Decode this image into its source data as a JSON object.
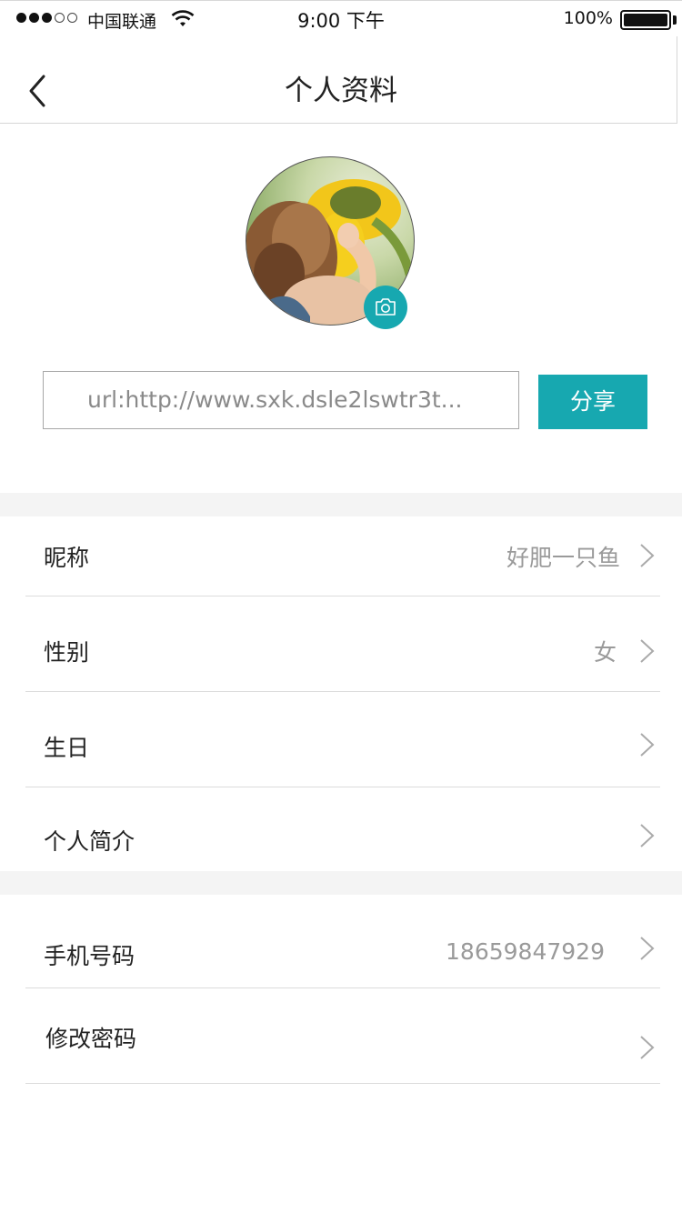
{
  "status_bar": {
    "carrier": "中国联通",
    "time": "9:00 下午",
    "battery_percent": "100%",
    "signal_bars_filled": 3,
    "signal_bars_total": 5
  },
  "nav": {
    "title": "个人资料",
    "back_icon": "chevron-left-icon"
  },
  "profile": {
    "avatar_alt": "avatar photo",
    "camera_icon": "camera-icon"
  },
  "share": {
    "url_value": "url:http://www.sxk.dsle2lswtr3t...",
    "button_label": "分享",
    "accent_color": "#17a8b0"
  },
  "sections": [
    {
      "rows": [
        {
          "label": "昵称",
          "value": "好肥一只鱼"
        },
        {
          "label": "性别",
          "value": "女"
        },
        {
          "label": "生日",
          "value": ""
        },
        {
          "label": "个人简介",
          "value": ""
        }
      ]
    },
    {
      "rows": [
        {
          "label": "手机号码",
          "value": "18659847929"
        },
        {
          "label": "修改密码",
          "value": ""
        }
      ]
    }
  ]
}
